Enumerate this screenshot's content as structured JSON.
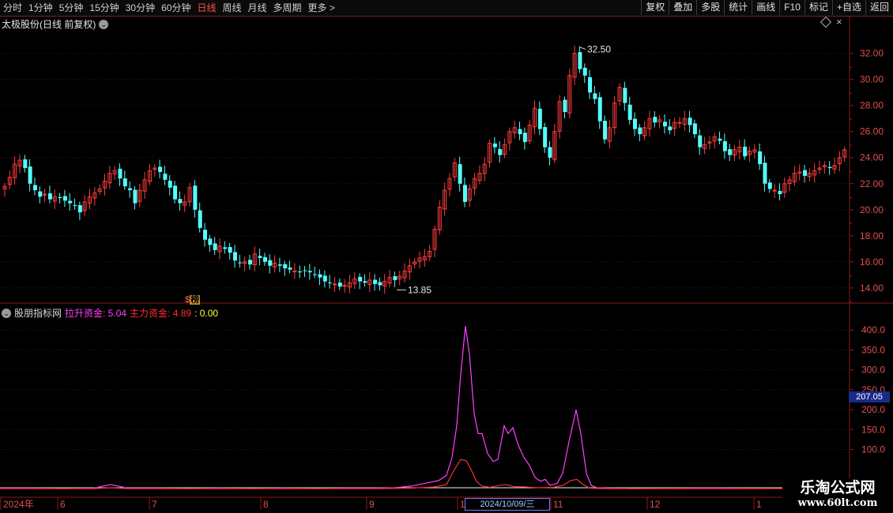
{
  "toolbar": {
    "periods": [
      {
        "label": "分时",
        "active": false
      },
      {
        "label": "1分钟",
        "active": false
      },
      {
        "label": "5分钟",
        "active": false
      },
      {
        "label": "15分钟",
        "active": false
      },
      {
        "label": "30分钟",
        "active": false
      },
      {
        "label": "60分钟",
        "active": false
      },
      {
        "label": "日线",
        "active": true
      },
      {
        "label": "周线",
        "active": false
      },
      {
        "label": "月线",
        "active": false
      },
      {
        "label": "多周期",
        "active": false
      },
      {
        "label": "更多 >",
        "active": false
      }
    ],
    "actions": [
      "复权",
      "叠加",
      "多股",
      "统计",
      "画线",
      "F10",
      "标记",
      "+自选",
      "返回"
    ]
  },
  "main_chart": {
    "title": "太极股份(日线 前复权)",
    "high_label": "32.50",
    "low_label": "13.85",
    "badge_dollar": "$",
    "badge_text": "榜",
    "y_ticks": [
      "32.00",
      "30.00",
      "28.00",
      "26.00",
      "24.00",
      "22.00",
      "20.00",
      "18.00",
      "16.00",
      "14.00"
    ]
  },
  "indicator": {
    "name": "股朋指标网",
    "line1_label": "拉升资金: 5.04",
    "line2_label": "主力资金: 4.89",
    "line3_label": ": 0.00",
    "y_ticks": [
      "400.0",
      "350.0",
      "300.0",
      "250.0",
      "200.0",
      "150.0",
      "100.0"
    ],
    "current_value": "207.05"
  },
  "x_axis": {
    "labels": [
      "2024年",
      "6",
      "7",
      "8",
      "9",
      "1",
      "11",
      "12",
      "1"
    ],
    "crosshair_date": "2024/10/09/三"
  },
  "watermark": {
    "line1": "乐淘公式网",
    "line2": "www.60lt.com"
  },
  "colors": {
    "up": "#ff3c3c",
    "down": "#54ffff",
    "indicator_magenta": "#ff40ff",
    "indicator_red": "#ff3030",
    "grid": "#5a0a0a",
    "axis": "#8a1c1c"
  },
  "chart_data": {
    "type": "candlestick",
    "ylim": [
      13.2,
      33.8
    ],
    "closes": [
      21.8,
      22.5,
      23.5,
      23.8,
      23.2,
      22.0,
      21.5,
      21.0,
      21.2,
      20.8,
      21.0,
      20.9,
      20.7,
      20.5,
      20.3,
      19.8,
      20.6,
      21.0,
      21.3,
      21.6,
      22.2,
      22.8,
      23.0,
      22.4,
      21.8,
      21.5,
      20.5,
      21.5,
      22.3,
      23.0,
      23.2,
      22.9,
      22.3,
      21.7,
      20.8,
      20.5,
      20.6,
      21.7,
      20.0,
      18.6,
      17.7,
      17.3,
      16.9,
      17.2,
      17.0,
      16.7,
      16.1,
      15.9,
      16.0,
      15.8,
      16.6,
      16.3,
      16.0,
      15.7,
      15.9,
      15.7,
      15.5,
      15.4,
      15.3,
      15.2,
      15.3,
      15.2,
      15.0,
      14.8,
      14.5,
      14.4,
      14.3,
      14.1,
      14.2,
      14.4,
      14.7,
      14.5,
      14.4,
      14.6,
      14.3,
      14.2,
      14.5,
      14.8,
      14.6,
      14.9,
      15.3,
      15.7,
      16.0,
      16.3,
      16.4,
      16.8,
      18.5,
      20.2,
      21.5,
      22.4,
      23.6,
      22.0,
      20.6,
      21.6,
      22.4,
      22.8,
      23.5,
      25.1,
      24.8,
      24.2,
      25.0,
      26.0,
      26.3,
      25.8,
      25.2,
      26.5,
      27.8,
      26.2,
      24.8,
      24.0,
      26.0,
      28.3,
      27.5,
      30.3,
      32.0,
      30.8,
      30.3,
      29.0,
      28.5,
      26.8,
      25.4,
      26.3,
      28.2,
      29.4,
      28.2,
      26.9,
      26.2,
      25.8,
      26.3,
      27.0,
      26.7,
      26.9,
      26.4,
      26.1,
      26.7,
      26.7,
      27.0,
      26.5,
      25.8,
      24.8,
      25.0,
      25.2,
      25.6,
      25.3,
      24.5,
      24.2,
      24.6,
      24.8,
      24.1,
      24.5,
      24.6,
      23.5,
      22.0,
      21.6,
      21.5,
      21.2,
      22.0,
      22.3,
      22.8,
      22.9,
      22.6,
      22.8,
      23.0,
      23.2,
      23.4,
      23.2,
      23.4,
      24.0,
      24.6
    ],
    "indicator_series": [
      {
        "name": "拉升资金",
        "ylim": [
          0,
          440
        ],
        "points": [
          [
            0,
            3
          ],
          [
            40,
            3
          ],
          [
            80,
            2
          ],
          [
            120,
            3
          ],
          [
            130,
            8
          ],
          [
            140,
            12
          ],
          [
            150,
            8
          ],
          [
            160,
            3
          ],
          [
            200,
            3
          ],
          [
            240,
            2
          ],
          [
            280,
            3
          ],
          [
            320,
            2
          ],
          [
            360,
            3
          ],
          [
            400,
            2
          ],
          [
            440,
            3
          ],
          [
            480,
            3
          ],
          [
            500,
            4
          ],
          [
            510,
            6
          ],
          [
            520,
            8
          ],
          [
            530,
            12
          ],
          [
            545,
            18
          ],
          [
            555,
            22
          ],
          [
            565,
            35
          ],
          [
            572,
            80
          ],
          [
            578,
            160
          ],
          [
            583,
            290
          ],
          [
            589,
            410
          ],
          [
            594,
            340
          ],
          [
            600,
            190
          ],
          [
            605,
            140
          ],
          [
            610,
            140
          ],
          [
            617,
            90
          ],
          [
            624,
            70
          ],
          [
            630,
            75
          ],
          [
            638,
            160
          ],
          [
            643,
            140
          ],
          [
            649,
            155
          ],
          [
            656,
            110
          ],
          [
            663,
            80
          ],
          [
            670,
            60
          ],
          [
            677,
            30
          ],
          [
            684,
            20
          ],
          [
            690,
            25
          ],
          [
            696,
            10
          ],
          [
            705,
            15
          ],
          [
            712,
            40
          ],
          [
            720,
            120
          ],
          [
            729,
            200
          ],
          [
            735,
            140
          ],
          [
            742,
            40
          ],
          [
            748,
            10
          ],
          [
            755,
            4
          ],
          [
            770,
            3
          ],
          [
            800,
            2
          ],
          [
            900,
            3
          ],
          [
            1000,
            2
          ],
          [
            1075,
            3
          ]
        ]
      },
      {
        "name": "主力资金",
        "ylim": [
          0,
          440
        ],
        "points": [
          [
            0,
            2
          ],
          [
            120,
            2
          ],
          [
            140,
            4
          ],
          [
            160,
            2
          ],
          [
            400,
            2
          ],
          [
            480,
            2
          ],
          [
            520,
            3
          ],
          [
            550,
            6
          ],
          [
            565,
            12
          ],
          [
            575,
            50
          ],
          [
            583,
            75
          ],
          [
            590,
            72
          ],
          [
            596,
            50
          ],
          [
            603,
            20
          ],
          [
            610,
            8
          ],
          [
            620,
            5
          ],
          [
            632,
            10
          ],
          [
            640,
            12
          ],
          [
            650,
            7
          ],
          [
            665,
            6
          ],
          [
            680,
            4
          ],
          [
            700,
            5
          ],
          [
            712,
            10
          ],
          [
            722,
            22
          ],
          [
            730,
            25
          ],
          [
            738,
            12
          ],
          [
            746,
            3
          ],
          [
            760,
            2
          ],
          [
            900,
            2
          ],
          [
            1075,
            2
          ]
        ]
      }
    ]
  }
}
